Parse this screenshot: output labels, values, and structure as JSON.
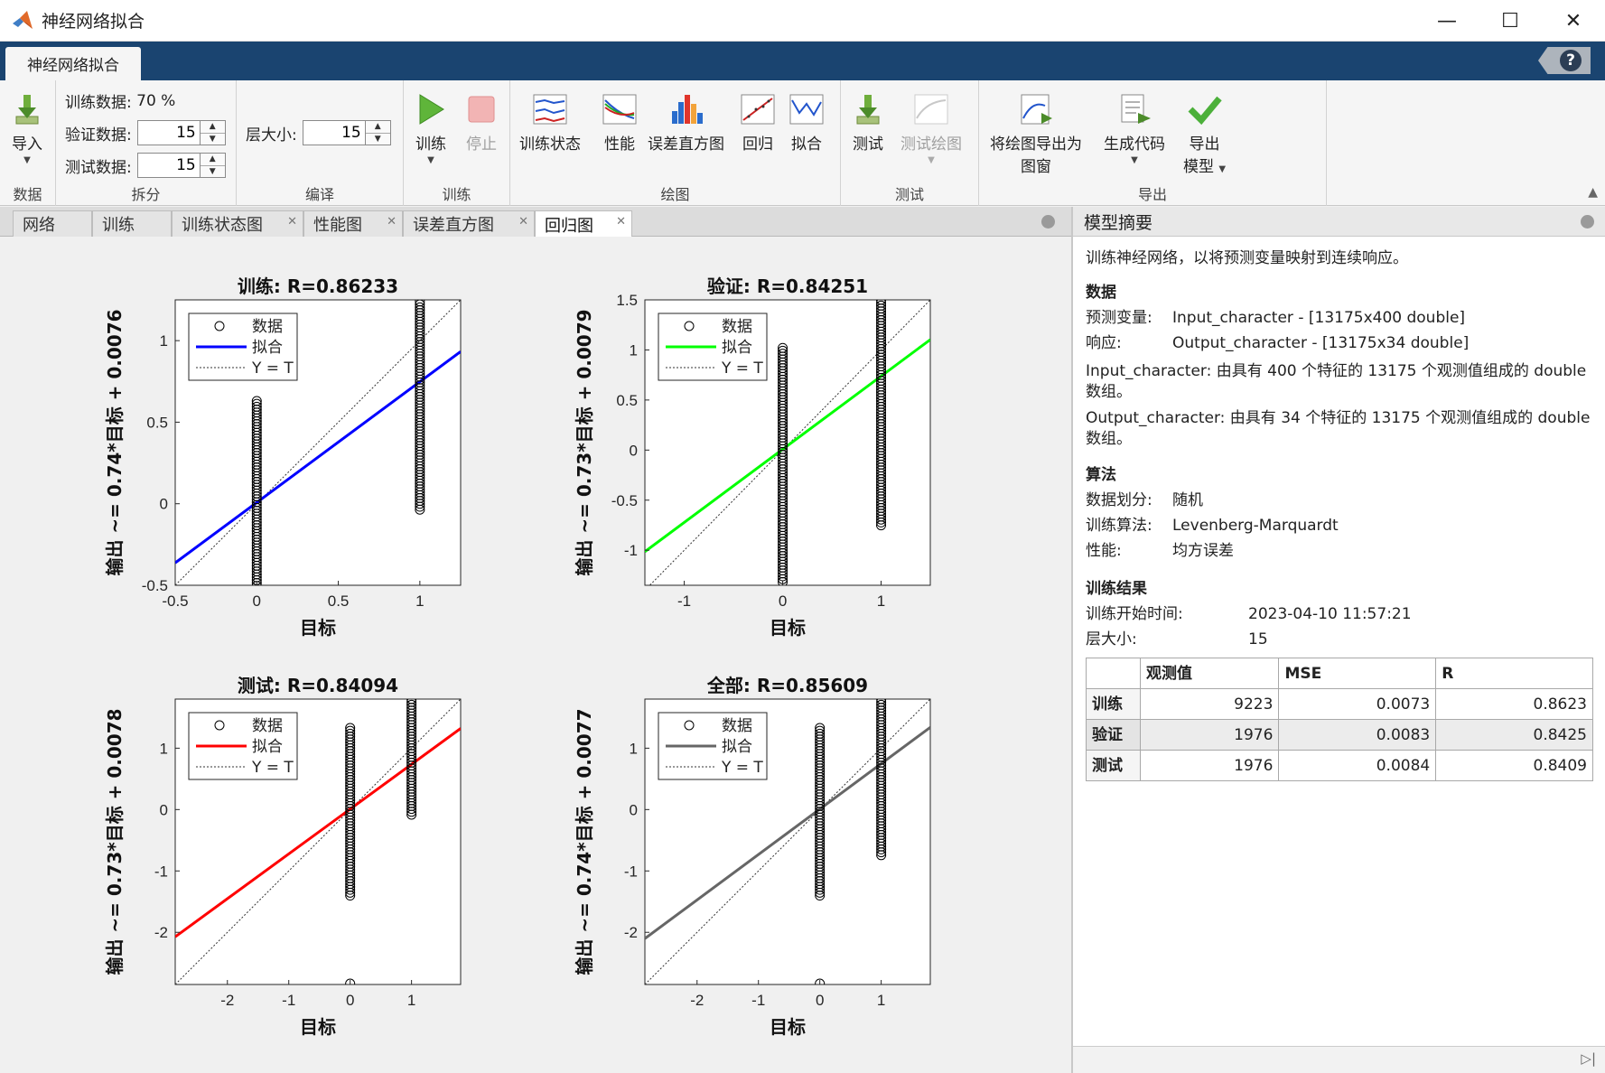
{
  "window": {
    "title": "神经网络拟合",
    "controls": [
      "—",
      "☐",
      "✕"
    ]
  },
  "ribbon": {
    "tab": "神经网络拟合",
    "help": "?",
    "data": {
      "import": "导入",
      "section": "数据"
    },
    "split": {
      "train_label": "训练数据:",
      "train_value": "70 %",
      "val_label": "验证数据:",
      "val_value": "15",
      "test_label": "测试数据:",
      "test_value": "15",
      "section": "拆分"
    },
    "compile": {
      "layer_label": "层大小:",
      "layer_value": "15",
      "section": "编译"
    },
    "train": {
      "train": "训练",
      "stop": "停止",
      "section": "训练"
    },
    "plot": {
      "state": "训练状态",
      "perf": "性能",
      "hist": "误差直方图",
      "regression": "回归",
      "fit": "拟合",
      "section": "绘图"
    },
    "test": {
      "test": "测试",
      "test_plot": "测试绘图",
      "section": "测试"
    },
    "export": {
      "export_fig_1": "将绘图导出为",
      "export_fig_2": "图窗",
      "gen_code": "生成代码",
      "export_model_1": "导出",
      "export_model_2": "模型",
      "section": "导出"
    }
  },
  "doc_tabs": [
    "网络",
    "训练",
    "训练状态图",
    "性能图",
    "误差直方图",
    "回归图"
  ],
  "chart_data": [
    {
      "type": "scatter",
      "title": "训练: R=0.86233",
      "xlabel": "目标",
      "ylabel": "输出 ~= 0.74*目标 + 0.0076",
      "xlim": [
        -0.5,
        1.25
      ],
      "ylim": [
        -0.5,
        1.25
      ],
      "xticks": [
        -0.5,
        0,
        0.5,
        1
      ],
      "yticks": [
        -0.5,
        0,
        0.5,
        1
      ],
      "fit": {
        "slope": 0.74,
        "intercept": 0.0076,
        "color": "#0000ff"
      },
      "clusters": [
        {
          "x": 0,
          "ymin": -0.51,
          "ymax": 0.63
        },
        {
          "x": 1,
          "ymin": -0.05,
          "ymax": 1.24
        }
      ],
      "legend": [
        "数据",
        "拟合",
        "Y = T"
      ]
    },
    {
      "type": "scatter",
      "title": "验证: R=0.84251",
      "xlabel": "目标",
      "ylabel": "输出 ~= 0.73*目标 + 0.0079",
      "xlim": [
        -1.4,
        1.5
      ],
      "ylim": [
        -1.35,
        1.5
      ],
      "xticks": [
        -1,
        0,
        1
      ],
      "yticks": [
        -1,
        -0.5,
        0,
        0.5,
        1,
        1.5
      ],
      "fit": {
        "slope": 0.73,
        "intercept": 0.0079,
        "color": "#00ff00"
      },
      "clusters": [
        {
          "x": 0,
          "ymin": -1.33,
          "ymax": 1.02
        },
        {
          "x": 1,
          "ymin": -0.77,
          "ymax": 1.5
        }
      ],
      "legend": [
        "数据",
        "拟合",
        "Y = T"
      ]
    },
    {
      "type": "scatter",
      "title": "测试: R=0.84094",
      "xlabel": "目标",
      "ylabel": "输出 ~= 0.73*目标 + 0.0078",
      "xlim": [
        -2.85,
        1.8
      ],
      "ylim": [
        -2.85,
        1.8
      ],
      "xticks": [
        -2,
        -1,
        0,
        1
      ],
      "yticks": [
        -2,
        -1,
        0,
        1
      ],
      "fit": {
        "slope": 0.73,
        "intercept": 0.0078,
        "color": "#ff0000"
      },
      "clusters": [
        {
          "x": 0,
          "ymin": -1.42,
          "ymax": 1.33
        },
        {
          "x": 1,
          "ymin": -0.1,
          "ymax": 1.8
        }
      ],
      "outliers": [
        {
          "x": 0,
          "y": -2.85
        }
      ],
      "legend": [
        "数据",
        "拟合",
        "Y = T"
      ]
    },
    {
      "type": "scatter",
      "title": "全部: R=0.85609",
      "xlabel": "目标",
      "ylabel": "输出 ~= 0.74*目标 + 0.0077",
      "xlim": [
        -2.85,
        1.8
      ],
      "ylim": [
        -2.85,
        1.8
      ],
      "xticks": [
        -2,
        -1,
        0,
        1
      ],
      "yticks": [
        -2,
        -1,
        0,
        1
      ],
      "fit": {
        "slope": 0.74,
        "intercept": 0.0077,
        "color": "#666666"
      },
      "clusters": [
        {
          "x": 0,
          "ymin": -1.42,
          "ymax": 1.33
        },
        {
          "x": 1,
          "ymin": -0.77,
          "ymax": 1.8
        }
      ],
      "outliers": [
        {
          "x": 0,
          "y": -2.85
        }
      ],
      "legend": [
        "数据",
        "拟合",
        "Y = T"
      ]
    }
  ],
  "summary": {
    "title": "模型摘要",
    "intro": "训练神经网络，以将预测变量映射到连续响应。",
    "data_heading": "数据",
    "predictor_label": "预测变量:",
    "predictor_value": "Input_character - [13175x400 double]",
    "response_label": "响应:",
    "response_value": "Output_character - [13175x34 double]",
    "input_desc": "Input_character: 由具有 400 个特征的 13175 个观测值组成的 double 数组。",
    "output_desc": "Output_character: 由具有 34 个特征的 13175 个观测值组成的 double 数组。",
    "algo_heading": "算法",
    "split_label": "数据划分:",
    "split_value": "随机",
    "trainalg_label": "训练算法:",
    "trainalg_value": "Levenberg-Marquardt",
    "perf_label": "性能:",
    "perf_value": "均方误差",
    "results_heading": "训练结果",
    "start_label": "训练开始时间:",
    "start_value": "2023-04-10 11:57:21",
    "layer_label": "层大小:",
    "layer_value": "15",
    "table": {
      "headers": [
        "",
        "观测值",
        "MSE",
        "R"
      ],
      "rows": [
        [
          "训练",
          "9223",
          "0.0073",
          "0.8623"
        ],
        [
          "验证",
          "1976",
          "0.0083",
          "0.8425"
        ],
        [
          "测试",
          "1976",
          "0.0084",
          "0.8409"
        ]
      ]
    }
  }
}
